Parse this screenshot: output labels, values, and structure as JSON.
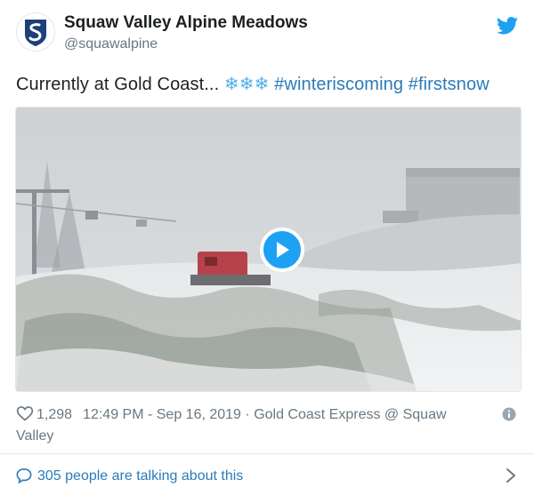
{
  "author": {
    "name": "Squaw Valley Alpine Meadows",
    "handle": "@squawalpine"
  },
  "tweet": {
    "text": "Currently at Gold Coast...",
    "emoji": "❄❄❄",
    "hashtags": [
      "#winteriscoming",
      "#firstsnow"
    ]
  },
  "media": {
    "type": "video",
    "play_icon": "play-icon"
  },
  "footer": {
    "likes": "1,298",
    "timestamp": "12:49 PM - Sep 16, 2019",
    "separator": "·",
    "location": "Gold Coast Express @ Squaw Valley",
    "talking": "305 people are talking about this"
  },
  "colors": {
    "accent": "#1da1f2",
    "link": "#2b7bb9",
    "muted": "#697882",
    "text": "#1c2022"
  },
  "icons": [
    "squaw-logo-icon",
    "twitter-bird-icon",
    "heart-icon",
    "info-icon",
    "speech-bubble-icon",
    "chevron-right-icon"
  ]
}
